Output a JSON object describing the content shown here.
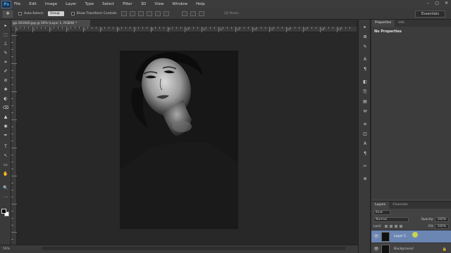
{
  "menubar": {
    "logo": "Ps",
    "items": [
      "File",
      "Edit",
      "Image",
      "Layer",
      "Type",
      "Select",
      "Filter",
      "3D",
      "View",
      "Window",
      "Help"
    ],
    "window_controls": [
      "–",
      "▢",
      "✕"
    ]
  },
  "options": {
    "tool_glyph": "✥",
    "auto_select_label": "Auto-Select:",
    "auto_select_value": "Group",
    "transform_label": "Show Transform Controls",
    "mode3d_label": "3D Mode:",
    "workspace": "Essentials"
  },
  "document": {
    "tab_title": "gjs-201640.jpg @ 50% (Layer 1, RGB/8) *"
  },
  "ruler": {
    "labels": [
      "0",
      "1",
      "2",
      "3",
      "4",
      "5",
      "6",
      "7",
      "8",
      "9",
      "10",
      "11",
      "12",
      "13",
      "14",
      "15",
      "16",
      "17",
      "18",
      "19"
    ]
  },
  "tools": [
    "▸",
    "⬚",
    "ℒ",
    "✎",
    "⌗",
    "✐",
    "⊘",
    "✚",
    "◐",
    "⌫",
    "▲",
    "◉",
    "✒",
    "T",
    "↖",
    "▭",
    "✋",
    "🔍",
    "⋯"
  ],
  "dock_icons": [
    "▸",
    "⊞",
    "✎",
    "A",
    "¶",
    "◧",
    "⎘",
    "▤",
    "✉",
    "≡",
    "◫",
    "A",
    "¶",
    "✂",
    "⊕"
  ],
  "properties": {
    "tabs": [
      "Properties",
      "Info"
    ],
    "title": "No Properties"
  },
  "layers": {
    "tabs": [
      "Layers",
      "Channels"
    ],
    "kind_label": "Kind",
    "blend_mode": "Normal",
    "opacity_label": "Opacity:",
    "opacity_value": "100%",
    "lock_label": "Lock:",
    "fill_label": "Fill:",
    "fill_value": "100%",
    "items": [
      {
        "name": "Layer 1",
        "visible": true,
        "selected": true
      },
      {
        "name": "Background",
        "visible": true,
        "selected": false,
        "locked": true
      }
    ]
  },
  "status": {
    "zoom": "50%"
  },
  "colors": {
    "selection": "#6b86b3",
    "ps_blue": "#39b4f4"
  }
}
